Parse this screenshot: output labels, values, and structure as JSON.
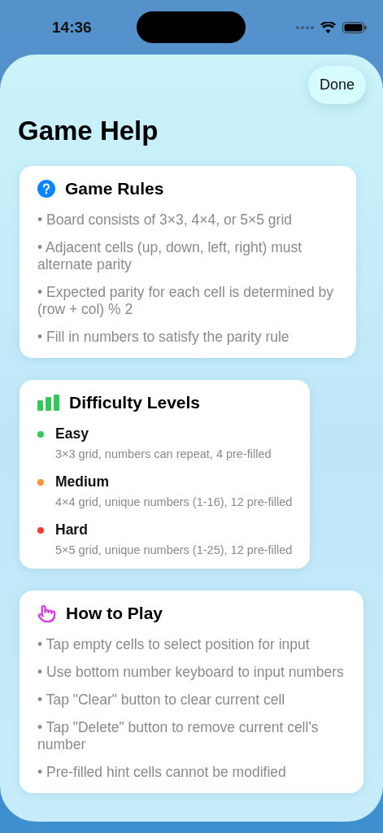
{
  "status_bar": {
    "time": "14:36"
  },
  "sheet": {
    "done_button": "Done",
    "title": "Game Help"
  },
  "sections": [
    {
      "kind": "bullets",
      "title": "Game Rules",
      "items": [
        "• Board consists of 3×3, 4×4, or 5×5 grid",
        "• Adjacent cells (up, down, left, right) must alternate parity",
        "• Expected parity for each cell is determined by (row + col) % 2",
        "• Fill in numbers to satisfy the parity rule"
      ]
    },
    {
      "kind": "levels",
      "title": "Difficulty Levels",
      "levels": [
        {
          "name": "Easy",
          "color": "#34c759",
          "description": "3×3 grid, numbers can repeat, 4 pre-filled"
        },
        {
          "name": "Medium",
          "color": "#ff9230",
          "description": "4×4 grid, unique numbers (1-16), 12 pre-filled"
        },
        {
          "name": "Hard",
          "color": "#ff3b30",
          "description": "5×5 grid, unique numbers (1-25), 12 pre-filled"
        }
      ]
    },
    {
      "kind": "bullets",
      "title": "How to Play",
      "items": [
        "• Tap empty cells to select position for input",
        "• Use bottom number keyboard to input numbers",
        "• Tap \"Clear\" button to clear current cell",
        "• Tap \"Delete\" button to remove current cell's number",
        "• Pre-filled hint cells cannot be modified"
      ]
    }
  ]
}
